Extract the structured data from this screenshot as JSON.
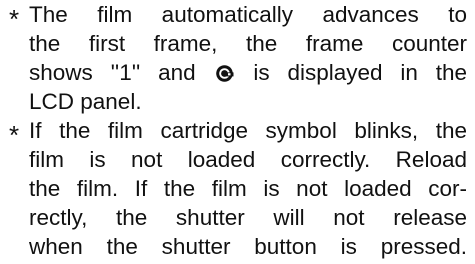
{
  "bullets": [
    "*",
    "*"
  ],
  "paragraphs": [
    {
      "lines": [
        "The film automatically advances to",
        "the first frame, the frame counter",
        {
          "before": "shows ''1'' and",
          "icon": "film-cartridge-icon",
          "after": "is displayed in the"
        },
        "LCD panel."
      ]
    },
    {
      "lines": [
        "If the film cartridge symbol blinks, the",
        "film is not loaded correctly. Reload",
        "the film. If the film is not loaded cor-",
        "rectly, the shutter will not release",
        "when the shutter button is pressed."
      ]
    }
  ]
}
